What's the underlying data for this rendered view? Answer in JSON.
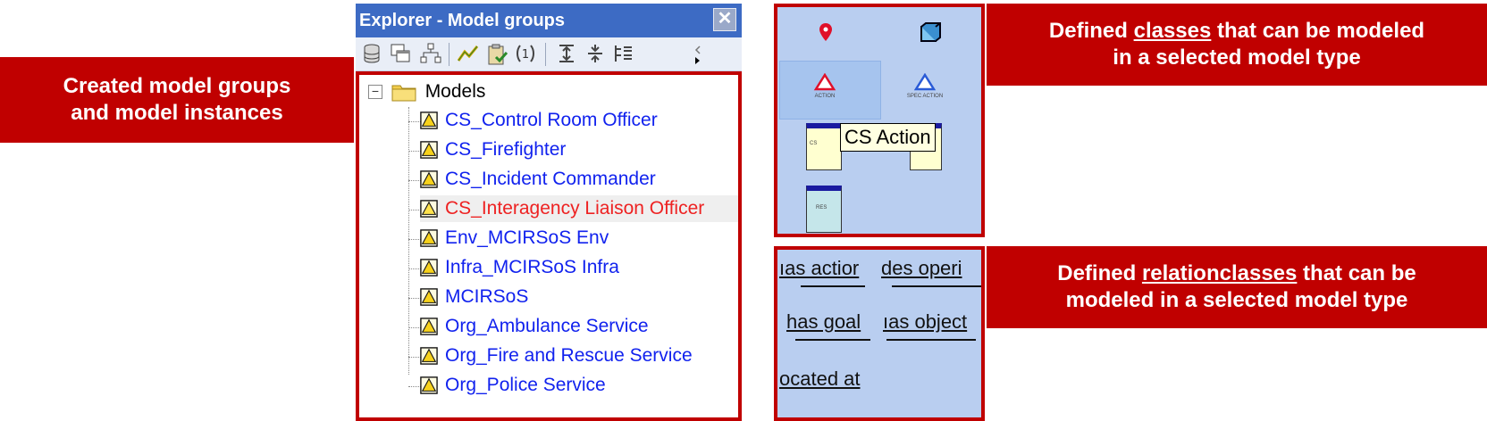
{
  "callouts": {
    "model_groups": {
      "line1": "Created model groups",
      "line2": "and model instances"
    },
    "classes": {
      "line1_pre": "Defined ",
      "line1_u": "classes",
      "line1_post": " that can be modeled",
      "line2": "in a selected model type"
    },
    "relationclasses": {
      "line1_pre": "Defined ",
      "line1_u": "relationclasses",
      "line1_post": " that can be",
      "line2": "modeled in a selected model type"
    }
  },
  "explorer": {
    "title": "Explorer - Model groups",
    "close_glyph": "✕",
    "toolbar_icons": [
      "database-icon",
      "windows-icon",
      "hierarchy-icon",
      "chart-icon",
      "clipboard-check-icon",
      "counter-icon",
      "expand-icon",
      "collapse-icon",
      "tree-expand-icon"
    ],
    "root": {
      "label": "Models",
      "toggle": "−"
    },
    "items": [
      {
        "label": "CS_Control Room Officer",
        "selected": false
      },
      {
        "label": "CS_Firefighter",
        "selected": false
      },
      {
        "label": "CS_Incident Commander",
        "selected": false
      },
      {
        "label": "CS_Interagency Liaison Officer",
        "selected": true
      },
      {
        "label": "Env_MCIRSoS Env",
        "selected": false
      },
      {
        "label": "Infra_MCIRSoS Infra",
        "selected": false
      },
      {
        "label": "MCIRSoS",
        "selected": false
      },
      {
        "label": "Org_Ambulance Service",
        "selected": false
      },
      {
        "label": "Org_Fire and Rescue Service",
        "selected": false
      },
      {
        "label": "Org_Police Service",
        "selected": false
      }
    ]
  },
  "class_palette": {
    "tooltip": "CS Action",
    "items": [
      "location-pin-icon",
      "cube-icon",
      "action-icon",
      "spec-action-icon",
      "cs-goal-icon",
      "goal-icon",
      "res-icon"
    ],
    "mini_labels": {
      "action": "ACTION",
      "spec_action": "SPEC ACTION",
      "cs": "CS",
      "res": "RES"
    }
  },
  "relation_palette": {
    "items": [
      "has action",
      "des operation",
      "has goal",
      "has objective",
      "located at"
    ],
    "visible": [
      "ıas actior",
      "des operi",
      "has goal",
      "ıas object",
      "ocated at"
    ]
  }
}
